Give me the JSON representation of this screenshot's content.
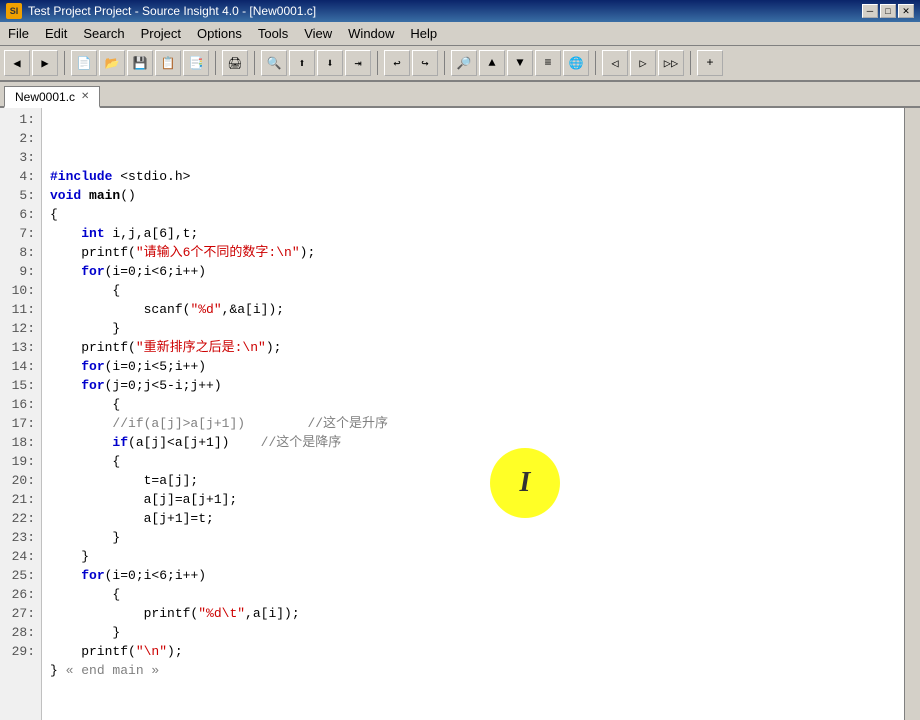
{
  "title_bar": {
    "icon_label": "SI",
    "title": "Test Project Project - Source Insight 4.0 - [New0001.c]",
    "win_minimize": "─",
    "win_maximize": "□",
    "win_close": "✕"
  },
  "menu": {
    "items": [
      "File",
      "Edit",
      "Search",
      "Project",
      "Options",
      "Tools",
      "View",
      "Window",
      "Help"
    ]
  },
  "tab": {
    "label": "New0001.c",
    "close": "✕"
  },
  "code": {
    "lines": [
      {
        "num": "1:",
        "text_plain": "#include <stdio.h>",
        "parts": [
          {
            "t": "kw",
            "v": "#include"
          },
          {
            "t": "plain",
            "v": " <stdio.h>"
          }
        ]
      },
      {
        "num": "2:",
        "text_plain": "void main()",
        "parts": [
          {
            "t": "kw",
            "v": "void"
          },
          {
            "t": "plain",
            "v": " "
          },
          {
            "t": "bold",
            "v": "main"
          },
          {
            "t": "plain",
            "v": "()"
          }
        ]
      },
      {
        "num": "3:",
        "text_plain": "{",
        "parts": [
          {
            "t": "plain",
            "v": "{"
          }
        ]
      },
      {
        "num": "4:",
        "text_plain": "    int i,j,a[6],t;",
        "parts": [
          {
            "t": "plain",
            "v": "    "
          },
          {
            "t": "kw",
            "v": "int"
          },
          {
            "t": "plain",
            "v": " i,j,a[6],t;"
          }
        ]
      },
      {
        "num": "5:",
        "text_plain": "    printf(\"请输入6个不同的数字:\\n\");",
        "parts": [
          {
            "t": "plain",
            "v": "    printf("
          },
          {
            "t": "str",
            "v": "\"请输入6个不同的数字:\\n\""
          },
          {
            "t": "plain",
            "v": ");"
          }
        ]
      },
      {
        "num": "6:",
        "text_plain": "    for(i=0;i<6;i++)",
        "parts": [
          {
            "t": "plain",
            "v": "    "
          },
          {
            "t": "kw",
            "v": "for"
          },
          {
            "t": "plain",
            "v": "(i=0;i<6;i++)"
          }
        ]
      },
      {
        "num": "7:",
        "text_plain": "        {",
        "parts": [
          {
            "t": "plain",
            "v": "        {"
          }
        ]
      },
      {
        "num": "8:",
        "text_plain": "            scanf(\"%d\",&a[i]);",
        "parts": [
          {
            "t": "plain",
            "v": "            scanf("
          },
          {
            "t": "str",
            "v": "\"%d\""
          },
          {
            "t": "plain",
            "v": ",&a[i]);"
          }
        ]
      },
      {
        "num": "9:",
        "text_plain": "        }",
        "parts": [
          {
            "t": "plain",
            "v": "        }"
          }
        ]
      },
      {
        "num": "10:",
        "text_plain": "    printf(\"重新排序之后是:\\n\");",
        "parts": [
          {
            "t": "plain",
            "v": "    printf("
          },
          {
            "t": "str",
            "v": "\"重新排序之后是:\\n\""
          },
          {
            "t": "plain",
            "v": ");"
          }
        ]
      },
      {
        "num": "11:",
        "text_plain": "    for(i=0;i<5;i++)",
        "parts": [
          {
            "t": "plain",
            "v": "    "
          },
          {
            "t": "kw",
            "v": "for"
          },
          {
            "t": "plain",
            "v": "(i=0;i<5;i++)"
          }
        ]
      },
      {
        "num": "12:",
        "text_plain": "    for(j=0;j<5-i;j++)",
        "parts": [
          {
            "t": "plain",
            "v": "    "
          },
          {
            "t": "kw",
            "v": "for"
          },
          {
            "t": "plain",
            "v": "(j=0;j<5-i;j++)"
          }
        ]
      },
      {
        "num": "13:",
        "text_plain": "        {",
        "parts": [
          {
            "t": "plain",
            "v": "        {"
          }
        ]
      },
      {
        "num": "14:",
        "text_plain": "        //if(a[j]>a[j+1])        //这个是升序",
        "parts": [
          {
            "t": "plain",
            "v": "        "
          },
          {
            "t": "comment",
            "v": "//if(a[j]>a[j+1])        //这个是升序"
          }
        ]
      },
      {
        "num": "15:",
        "text_plain": "        if(a[j]<a[j+1])    //这个是降序",
        "parts": [
          {
            "t": "plain",
            "v": "        "
          },
          {
            "t": "kw",
            "v": "if"
          },
          {
            "t": "plain",
            "v": "(a[j]<a[j+1])    "
          },
          {
            "t": "comment",
            "v": "//这个是降序"
          }
        ]
      },
      {
        "num": "16:",
        "text_plain": "        {",
        "parts": [
          {
            "t": "plain",
            "v": "        {"
          }
        ]
      },
      {
        "num": "17:",
        "text_plain": "            t=a[j];",
        "parts": [
          {
            "t": "plain",
            "v": "            t=a[j];"
          }
        ]
      },
      {
        "num": "18:",
        "text_plain": "            a[j]=a[j+1];",
        "parts": [
          {
            "t": "plain",
            "v": "            a[j]=a[j+1];"
          }
        ]
      },
      {
        "num": "19:",
        "text_plain": "            a[j+1]=t;",
        "parts": [
          {
            "t": "plain",
            "v": "            a[j+1]=t;"
          }
        ]
      },
      {
        "num": "20:",
        "text_plain": "        }",
        "parts": [
          {
            "t": "plain",
            "v": "        }"
          }
        ]
      },
      {
        "num": "21:",
        "text_plain": "    }",
        "parts": [
          {
            "t": "plain",
            "v": "    }"
          }
        ]
      },
      {
        "num": "22:",
        "text_plain": "    for(i=0;i<6;i++)",
        "parts": [
          {
            "t": "plain",
            "v": "    "
          },
          {
            "t": "kw",
            "v": "for"
          },
          {
            "t": "plain",
            "v": "(i=0;i<6;i++)"
          }
        ]
      },
      {
        "num": "23:",
        "text_plain": "        {",
        "parts": [
          {
            "t": "plain",
            "v": "        {"
          }
        ]
      },
      {
        "num": "24:",
        "text_plain": "            printf(\"%d\\t\",a[i]);",
        "parts": [
          {
            "t": "plain",
            "v": "            printf("
          },
          {
            "t": "str",
            "v": "\"%d\\t\""
          },
          {
            "t": "plain",
            "v": ",a[i]);"
          }
        ]
      },
      {
        "num": "25:",
        "text_plain": "        }",
        "parts": [
          {
            "t": "plain",
            "v": "        }"
          }
        ]
      },
      {
        "num": "26:",
        "text_plain": "    printf(\"\\n\");",
        "parts": [
          {
            "t": "plain",
            "v": "    printf("
          },
          {
            "t": "str",
            "v": "\"\\n\""
          },
          {
            "t": "plain",
            "v": ");"
          }
        ]
      },
      {
        "num": "27:",
        "text_plain": "} « end main »",
        "parts": [
          {
            "t": "plain",
            "v": "} "
          },
          {
            "t": "comment",
            "v": "« end main »"
          }
        ]
      },
      {
        "num": "28:",
        "text_plain": "",
        "parts": []
      },
      {
        "num": "29:",
        "text_plain": "",
        "parts": []
      }
    ]
  },
  "cursor": {
    "symbol": "I"
  }
}
